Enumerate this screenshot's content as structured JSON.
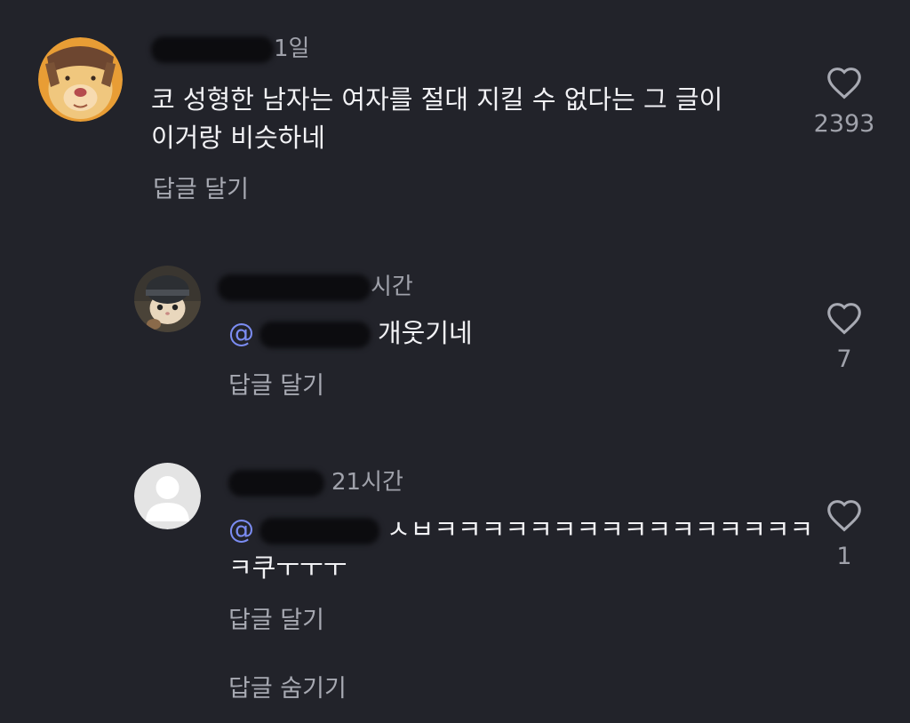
{
  "comments": [
    {
      "time": "1일",
      "text_line1": "코 성형한 남자는 여자를 절대 지킬 수 없다는 그 글이",
      "text_line2": "이거랑 비슷하네",
      "reply_label": "답글 달기",
      "likes": "2393",
      "avatar_icon": "dog-face-avatar"
    },
    {
      "time": "시간",
      "mention": "@",
      "text": "개웃기네",
      "reply_label": "답글 달기",
      "likes": "7",
      "avatar_icon": "cat-helmet-avatar"
    },
    {
      "time": "21시간",
      "mention": "@",
      "text_line1": "ㅅㅂㅋㅋㅋㅋㅋㅋㅋㅋㅋㅋㅋㅋㅋㅋㅋㅋ",
      "text_line2": "ㅋ쿠ㅜㅜㅜ",
      "reply_label": "답글 달기",
      "likes": "1",
      "avatar_icon": "default-user-avatar"
    }
  ],
  "hide_replies_label": "답글 숨기기",
  "colors": {
    "background": "#22232a",
    "text": "#f2f2f5",
    "secondary": "#a0a2ab",
    "mention": "#7b8cf2"
  },
  "icons": {
    "like": "heart-outline-icon"
  }
}
